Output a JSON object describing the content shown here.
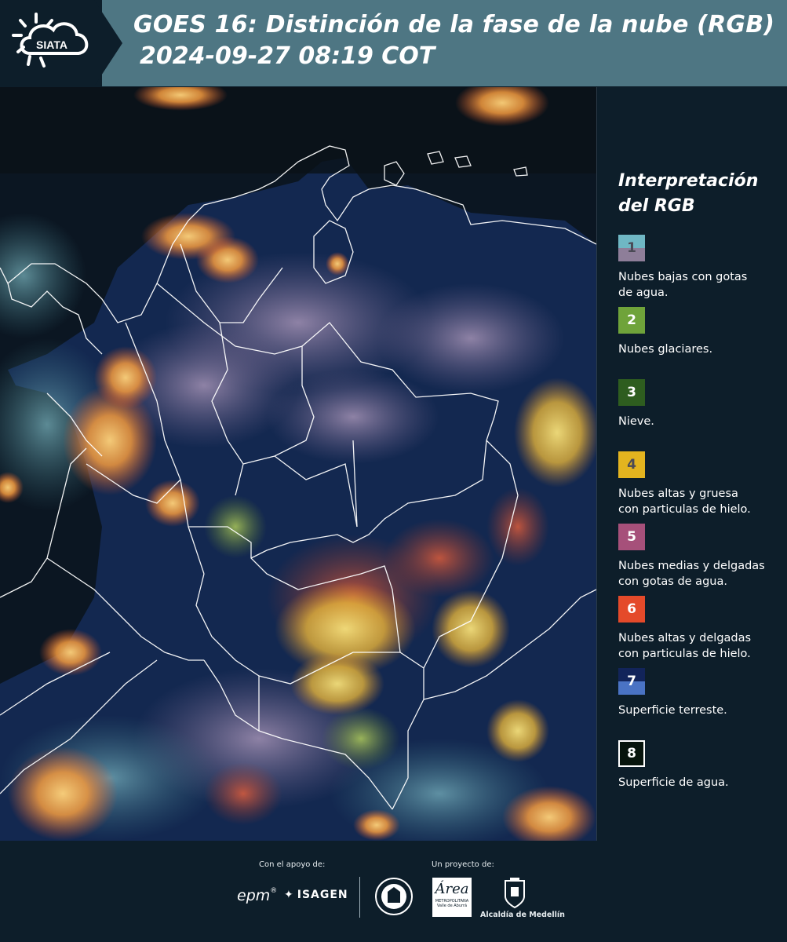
{
  "header": {
    "logo_text": "SIATA",
    "title_line1": "GOES 16: Distinción de la fase de la nube (RGB)",
    "title_line2": "2024-09-27 08:19 COT"
  },
  "legend": {
    "title_line1": "Interpretación",
    "title_line2": "del RGB",
    "items": [
      {
        "num": "1",
        "line1": "Nubes bajas con gotas",
        "line2": "de agua.",
        "top": "#6fb7c4",
        "bottom": "#8e7e99",
        "numColor": "#4a4a55"
      },
      {
        "num": "2",
        "line1": "Nubes glaciares.",
        "line2": "",
        "top": "#6fa33a",
        "bottom": "#6fa33a",
        "numColor": "#ffffff"
      },
      {
        "num": "3",
        "line1": "Nieve.",
        "line2": "",
        "top": "#2e5d1f",
        "bottom": "#2e5d1f",
        "numColor": "#ffffff"
      },
      {
        "num": "4",
        "line1": "Nubes altas y gruesa",
        "line2": "con particulas de hielo.",
        "top": "#e3b41f",
        "bottom": "#e3b41f",
        "numColor": "#4a4a55"
      },
      {
        "num": "5",
        "line1": "Nubes medias y delgadas",
        "line2": "con gotas de agua.",
        "top": "#a6507a",
        "bottom": "#a6507a",
        "numColor": "#ffffff"
      },
      {
        "num": "6",
        "line1": "Nubes altas y delgadas",
        "line2": "con particulas de hielo.",
        "top": "#e44a2a",
        "bottom": "#e44a2a",
        "numColor": "#ffffff"
      },
      {
        "num": "7",
        "line1": "Superficie terreste.",
        "line2": "",
        "top": "#12245a",
        "bottom": "#4a73c4",
        "numColor": "#ffffff"
      },
      {
        "num": "8",
        "line1": "Superficie de agua.",
        "line2": "",
        "top": "#07140c",
        "bottom": "#07140c",
        "numColor": "#ffffff"
      }
    ]
  },
  "footer": {
    "support_label": "Con el apoyo de:",
    "project_label": "Un proyecto de:",
    "sponsor1": "epm",
    "sponsor2": "ISAGEN",
    "area_text": "Área",
    "area_sub1": "METROPOLITANA",
    "area_sub2": "Valle de Aburrá",
    "alcaldia": "Alcaldía de Medellín"
  }
}
